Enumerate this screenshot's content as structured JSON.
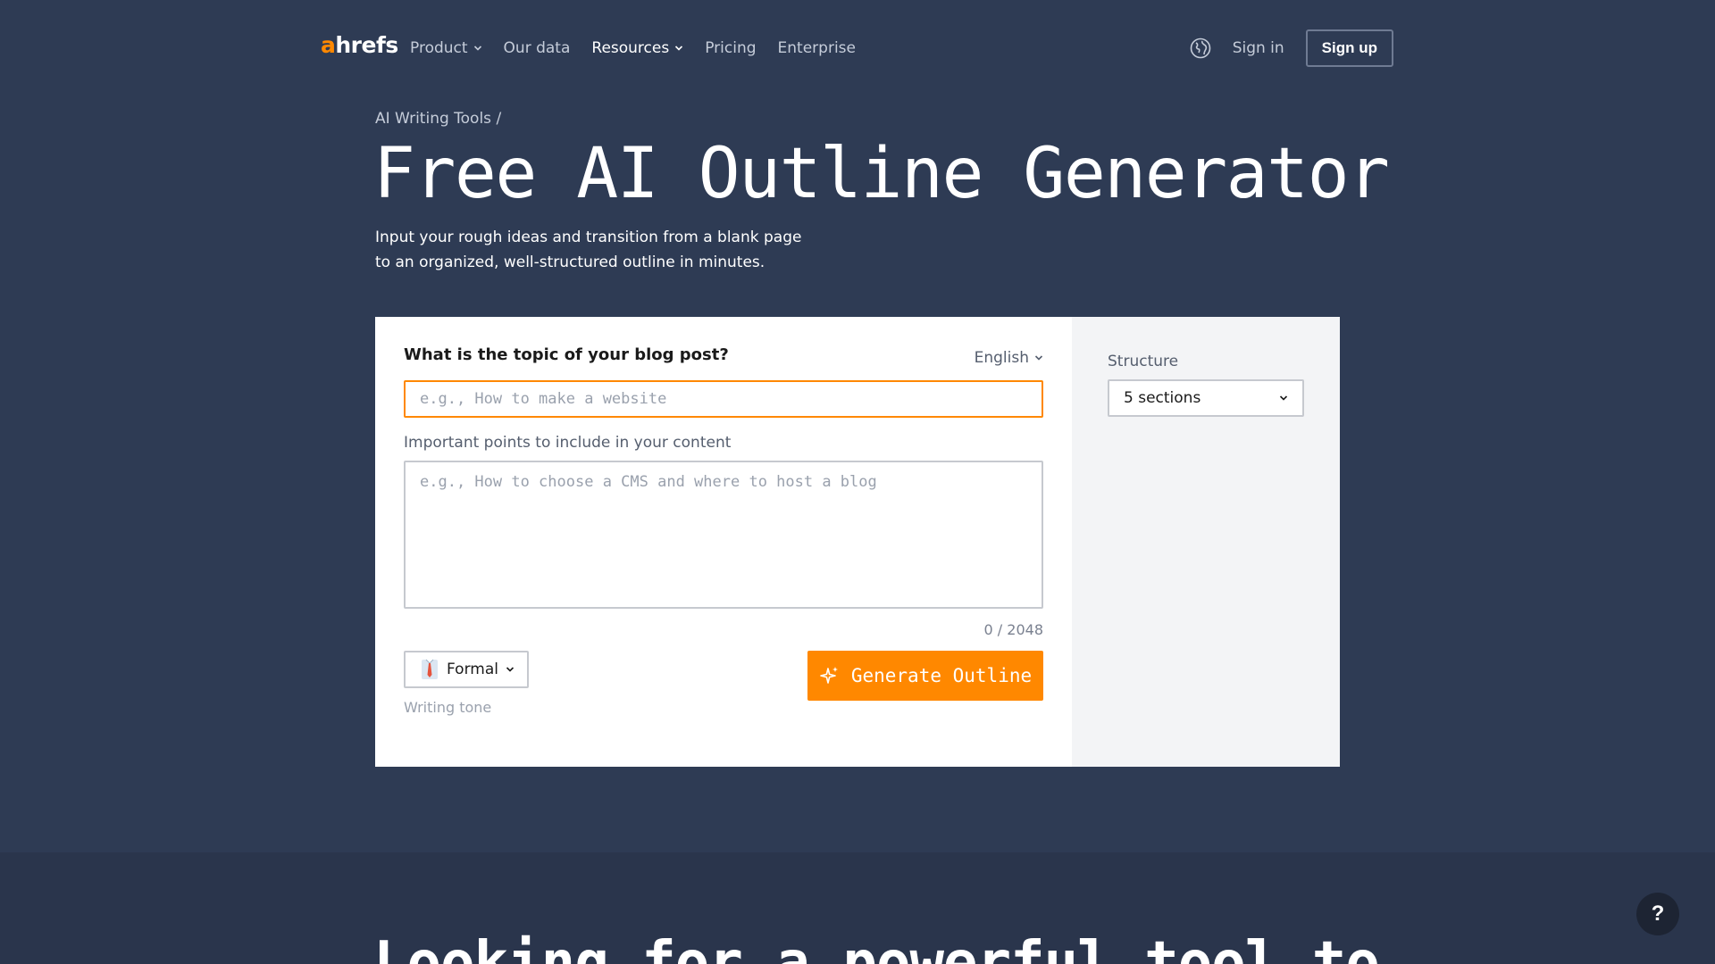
{
  "nav": {
    "logo_a": "a",
    "logo_rest": "hrefs",
    "links": [
      {
        "label": "Product",
        "has_dropdown": true,
        "active": false
      },
      {
        "label": "Our data",
        "has_dropdown": false,
        "active": false
      },
      {
        "label": "Resources",
        "has_dropdown": true,
        "active": true
      },
      {
        "label": "Pricing",
        "has_dropdown": false,
        "active": false
      },
      {
        "label": "Enterprise",
        "has_dropdown": false,
        "active": false
      }
    ],
    "globe_icon": "globe-icon",
    "signin_label": "Sign in",
    "signup_label": "Sign up"
  },
  "hero": {
    "breadcrumb": "AI Writing Tools /",
    "title": "Free AI Outline Generator",
    "subtitle_line1": "Input your rough ideas and transition from a blank page",
    "subtitle_line2": "to an organized, well-structured outline in minutes."
  },
  "tool": {
    "topic_label": "What is the topic of your blog post?",
    "language": "English",
    "topic_placeholder": "e.g., How to make a website",
    "topic_value": "",
    "points_label": "Important points to include in your content",
    "points_placeholder": "e.g., How to choose a CMS and where to host a blog",
    "points_value": "",
    "counter": "0 / 2048",
    "tone_value": "Formal",
    "tone_icon": "necktie-icon",
    "tone_hint": "Writing tone",
    "generate_label": "Generate Outline",
    "generate_icon": "sparkle-icon",
    "structure_label": "Structure",
    "structure_value": "5 sections"
  },
  "lower": {
    "heading": "Looking for a powerful tool to"
  },
  "help": {
    "label": "?"
  },
  "colors": {
    "background": "#2e3b54",
    "accent": "#ff8800",
    "card": "#ffffff",
    "sidebar": "#f3f4f6"
  }
}
